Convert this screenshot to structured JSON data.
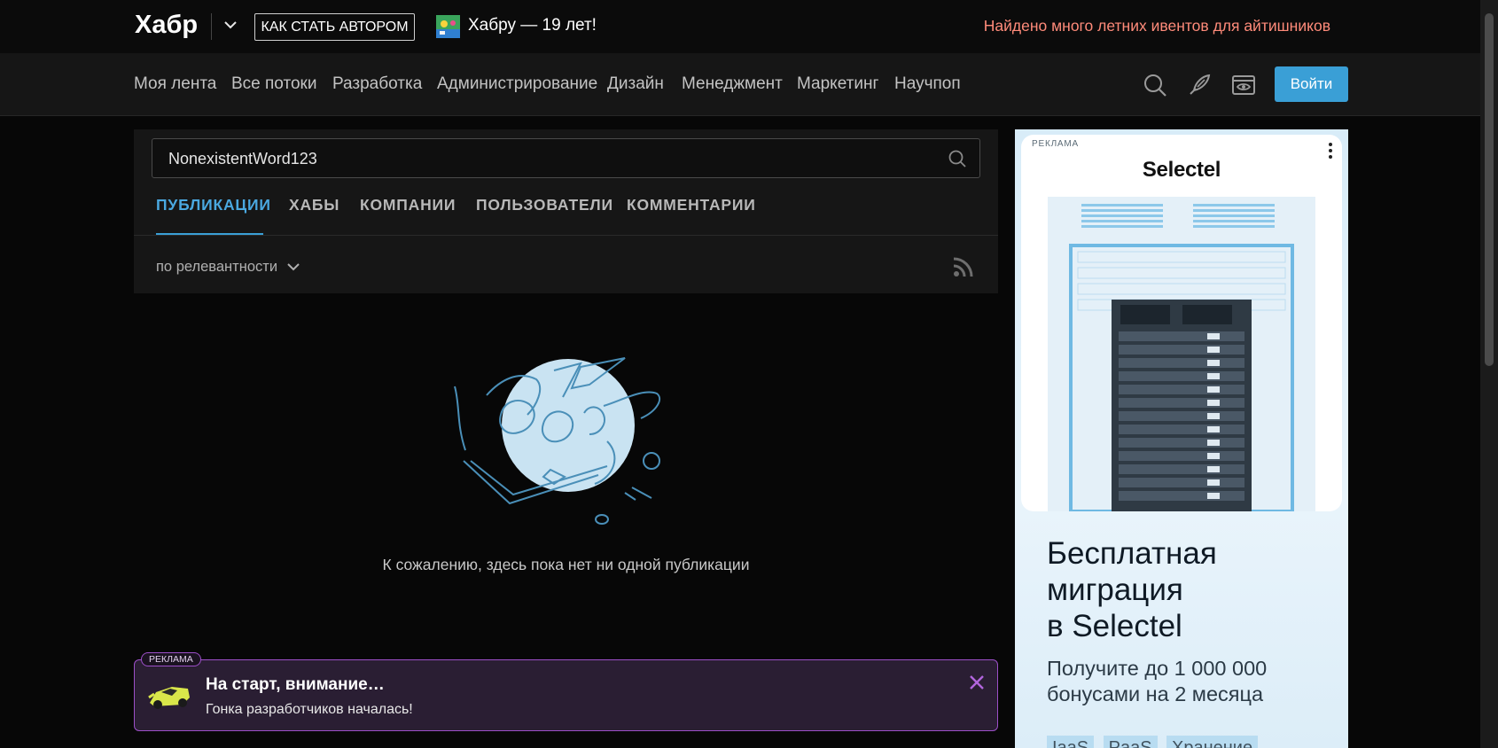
{
  "header": {
    "logo": "Хабр",
    "author_button": "КАК СТАТЬ АВТОРОМ",
    "anniversary": "Хабру — 19 лет!",
    "promo_link": "Найдено много летних ивентов для айтишников"
  },
  "nav": {
    "items": [
      "Моя лента",
      "Все потоки",
      "Разработка",
      "Администрирование",
      "Дизайн",
      "Менеджмент",
      "Маркетинг",
      "Научпоп"
    ],
    "icons": [
      "search-icon",
      "write-icon",
      "reading-mode-icon"
    ],
    "login": "Войти"
  },
  "search": {
    "value": "NonexistentWord123",
    "tabs": [
      "ПУБЛИКАЦИИ",
      "ХАБЫ",
      "КОМПАНИИ",
      "ПОЛЬЗОВАТЕЛИ",
      "КОММЕНТАРИИ"
    ],
    "active_tab": "ПУБЛИКАЦИИ",
    "sort": "по релевантности"
  },
  "empty_state": {
    "message": "К сожалению, здесь пока нет ни одной публикации"
  },
  "bottom_promo": {
    "badge": "РЕКЛАМА",
    "title": "На старт, внимание…",
    "subtitle": "Гонка разработчиков началась!"
  },
  "side_ad": {
    "badge": "РЕКЛАМА",
    "brand": "Selectel",
    "title_lines": [
      "Бесплатная",
      "миграция",
      "в Selectel"
    ],
    "subtitle_lines": [
      "Получите до 1 000 000",
      "бонусами на 2 месяца"
    ],
    "chips": [
      "IaaS",
      "PaaS",
      "Хранение"
    ]
  },
  "colors": {
    "accent": "#3a9fd6",
    "promo_text": "#ff8b7a",
    "promo_border": "#9c4fc8"
  }
}
